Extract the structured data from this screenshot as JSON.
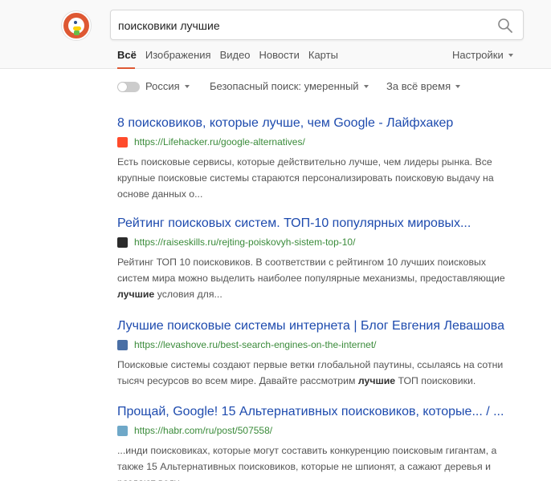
{
  "search": {
    "query": "поисковики лучшие",
    "placeholder": ""
  },
  "nav": {
    "tabs": [
      {
        "label": "Всё"
      },
      {
        "label": "Изображения"
      },
      {
        "label": "Видео"
      },
      {
        "label": "Новости"
      },
      {
        "label": "Карты"
      }
    ],
    "settings_label": "Настройки"
  },
  "filters": {
    "region": "Россия",
    "safe_search": "Безопасный поиск: умеренный",
    "time": "За всё время"
  },
  "results": [
    {
      "title": "8 поисковиков, которые лучше, чем Google - Лайфхакер",
      "url": "https://Lifehacker.ru/google-alternatives/",
      "favicon_color": "#ff4b2b",
      "snippet": [
        "Есть поисковые сервисы, которые действительно лучше, чем лидеры рынка. Все крупные поисковые системы стараются персонализировать поисковую выдачу на основе данных о..."
      ]
    },
    {
      "title": "Рейтинг поисковых систем. ТОП-10 популярных мировых...",
      "url": "https://raiseskills.ru/rejting-poiskovyh-sistem-top-10/",
      "favicon_color": "#2b2b2b",
      "snippet": [
        "Рейтинг ТОП 10 поисковиков. В соответствии с рейтингом 10 лучших поисковых систем мира можно выделить наиболее популярные механизмы, предоставляющие ",
        "лучшие",
        " условия для..."
      ]
    },
    {
      "title": "Лучшие поисковые системы интернета | Блог Евгения Левашова",
      "url": "https://levashove.ru/best-search-engines-on-the-internet/",
      "favicon_color": "#4a6fa5",
      "snippet": [
        "Поисковые системы создают первые ветки глобальной паутины, ссылаясь на сотни тысяч ресурсов во всем мире. Давайте рассмотрим ",
        "лучшие",
        " ТОП поисковики."
      ]
    },
    {
      "title": "Прощай, Google! 15 Альтернативных поисковиков, которые... / ...",
      "url": "https://habr.com/ru/post/507558/",
      "favicon_color": "#6fa8c8",
      "snippet": [
        "...инди поисковиках, которые могут составить конкуренцию поисковым гигантам, а также 15 Альтернативных поисковиков, которые не шпионят, а сажают деревья и раздают воду."
      ]
    }
  ],
  "colors": {
    "accent": "#de5833",
    "link": "#1e4bae",
    "url": "#3a8b3a"
  }
}
